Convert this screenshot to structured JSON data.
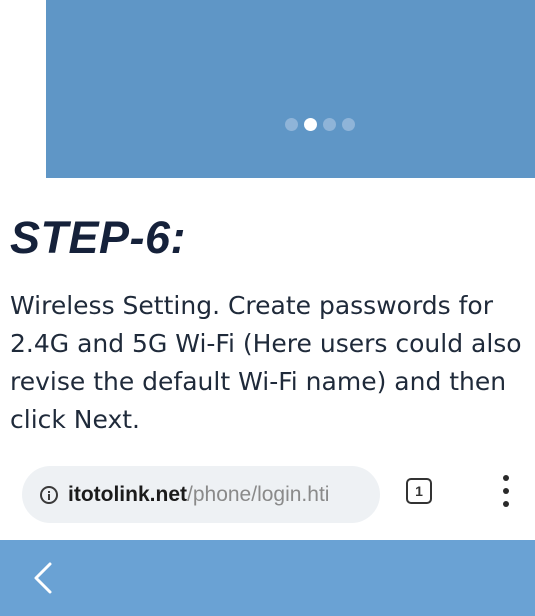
{
  "carousel": {
    "dot_count": 4,
    "active_index": 1,
    "background": "#5f96c6"
  },
  "step": {
    "title": "STEP-6:",
    "description": "Wireless Setting. Create passwords for 2.4G and 5G Wi-Fi (Here users could also revise the default Wi-Fi name) and then click Next."
  },
  "browser": {
    "info_icon": "info-icon",
    "url_domain": "itotolink.net",
    "url_path": "/phone/login.hti",
    "tab_count": "1",
    "menu_icon": "more-vertical-icon"
  },
  "app_header": {
    "back_icon": "chevron-left-icon",
    "background": "#6aa2d4"
  }
}
